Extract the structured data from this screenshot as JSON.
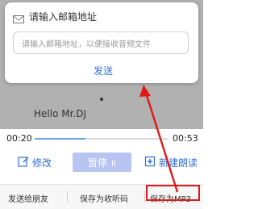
{
  "dialog": {
    "title": "请输入邮箱地址",
    "placeholder": "请输入邮箱地址，以便接收音频文件",
    "send_label": "发送"
  },
  "player": {
    "track_title": "Hello Mr.DJ",
    "time_current": "00:20",
    "time_total": "00:53",
    "progress": 0.38
  },
  "actions": {
    "edit_label": "修改",
    "pause_label": "暂停 ॥",
    "new_label": "新建朗读"
  },
  "bottom": {
    "send_friend_label": "发送给朋友",
    "save_code_label": "保存为收听码",
    "save_mp3_label": "保存为MP3"
  },
  "colors": {
    "accent": "#2e6fd8",
    "highlight": "#e01919",
    "pause_bg": "#b8c4f2"
  }
}
